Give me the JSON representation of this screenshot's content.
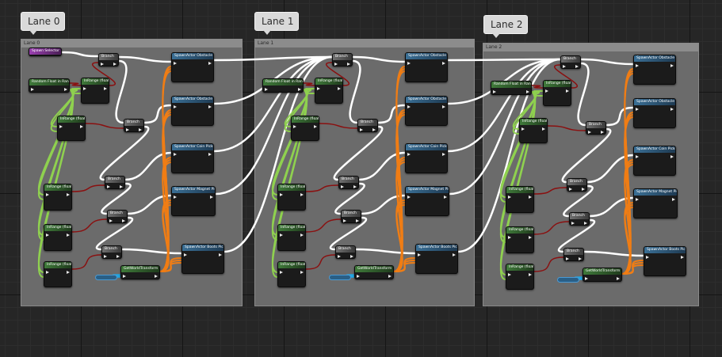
{
  "lanes": [
    {
      "tab": "Lane 0",
      "comment": "Lane 0"
    },
    {
      "tab": "Lane 1",
      "comment": "Lane 1"
    },
    {
      "tab": "Lane 2",
      "comment": "Lane 2"
    }
  ],
  "node_titles": {
    "spawn_selector": "Spawn Selector",
    "random_float": "Random Float in Range",
    "in_range": "InRange (float)",
    "branch": "Branch",
    "spawn_pipe": "SpawnActor Obstacle Pipe",
    "spawn_box": "SpawnActor Obstacle Box",
    "spawn_coin": "SpawnActor Coin Pickup",
    "spawn_magnet": "SpawnActor Magnet Pickup",
    "spawn_boots": "SpawnActor Boots Pickup",
    "get_world_transform": "GetWorldTransform"
  },
  "colors": {
    "exec_wire": "#ffffff",
    "bool_wire": "#8a1010",
    "float_wire": "#8fd14f",
    "transform_wire": "#f07d14",
    "object_wire": "#1ea9e8",
    "comment_fill": "#6b6b6b"
  }
}
